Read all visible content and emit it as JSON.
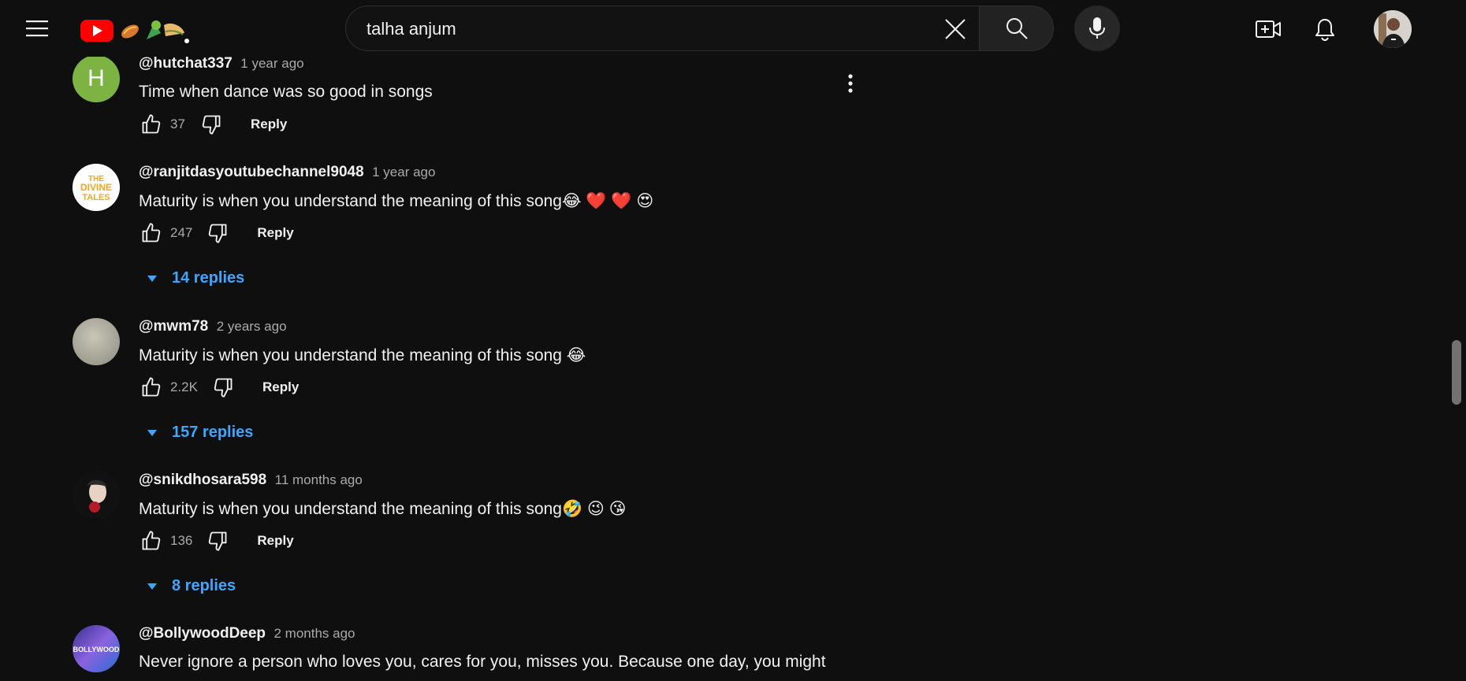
{
  "search": {
    "query": "talha anjum",
    "placeholder": "Search"
  },
  "comments": [
    {
      "author": "@hutchat337",
      "time": "1 year ago",
      "text": "Time when dance was so good in songs",
      "likes": "37",
      "reply_label": "Reply",
      "avatar_letter": "H",
      "avatar_color": "#7cb342"
    },
    {
      "author": "@ranjitdasyoutubechannel9048",
      "time": "1 year ago",
      "text": "Maturity is when you understand the meaning of this song😂 ❤️ ❤️ 😍",
      "likes": "247",
      "reply_label": "Reply",
      "replies": "14 replies",
      "avatar_text": "THE DIVINE TALES"
    },
    {
      "author": "@mwm78",
      "time": "2 years ago",
      "text": "Maturity is when you understand the meaning of this song 😂",
      "likes": "2.2K",
      "reply_label": "Reply",
      "replies": "157 replies"
    },
    {
      "author": "@snikdhosara598",
      "time": "11 months ago",
      "text": "Maturity is when you understand the meaning of this song🤣 😉 😘",
      "likes": "136",
      "reply_label": "Reply",
      "replies": "8 replies"
    },
    {
      "author": "@BollywoodDeep",
      "time": "2 months ago",
      "text": "Never ignore a person who loves you, cares for you, misses you. Because one day, you might",
      "avatar_text": "BOLLYWOOD"
    }
  ],
  "colors": {
    "background": "#0f0f0f",
    "link_blue": "#3ea6ff",
    "youtube_red": "#ff0000"
  },
  "icons": {
    "menu": "hamburger-icon",
    "logo": "youtube-logo-icon",
    "clear": "close-icon",
    "search": "search-icon",
    "mic": "microphone-icon",
    "create": "create-video-icon",
    "bell": "bell-icon",
    "like": "thumb-up-icon",
    "dislike": "thumb-down-icon",
    "more": "more-vert-icon"
  }
}
